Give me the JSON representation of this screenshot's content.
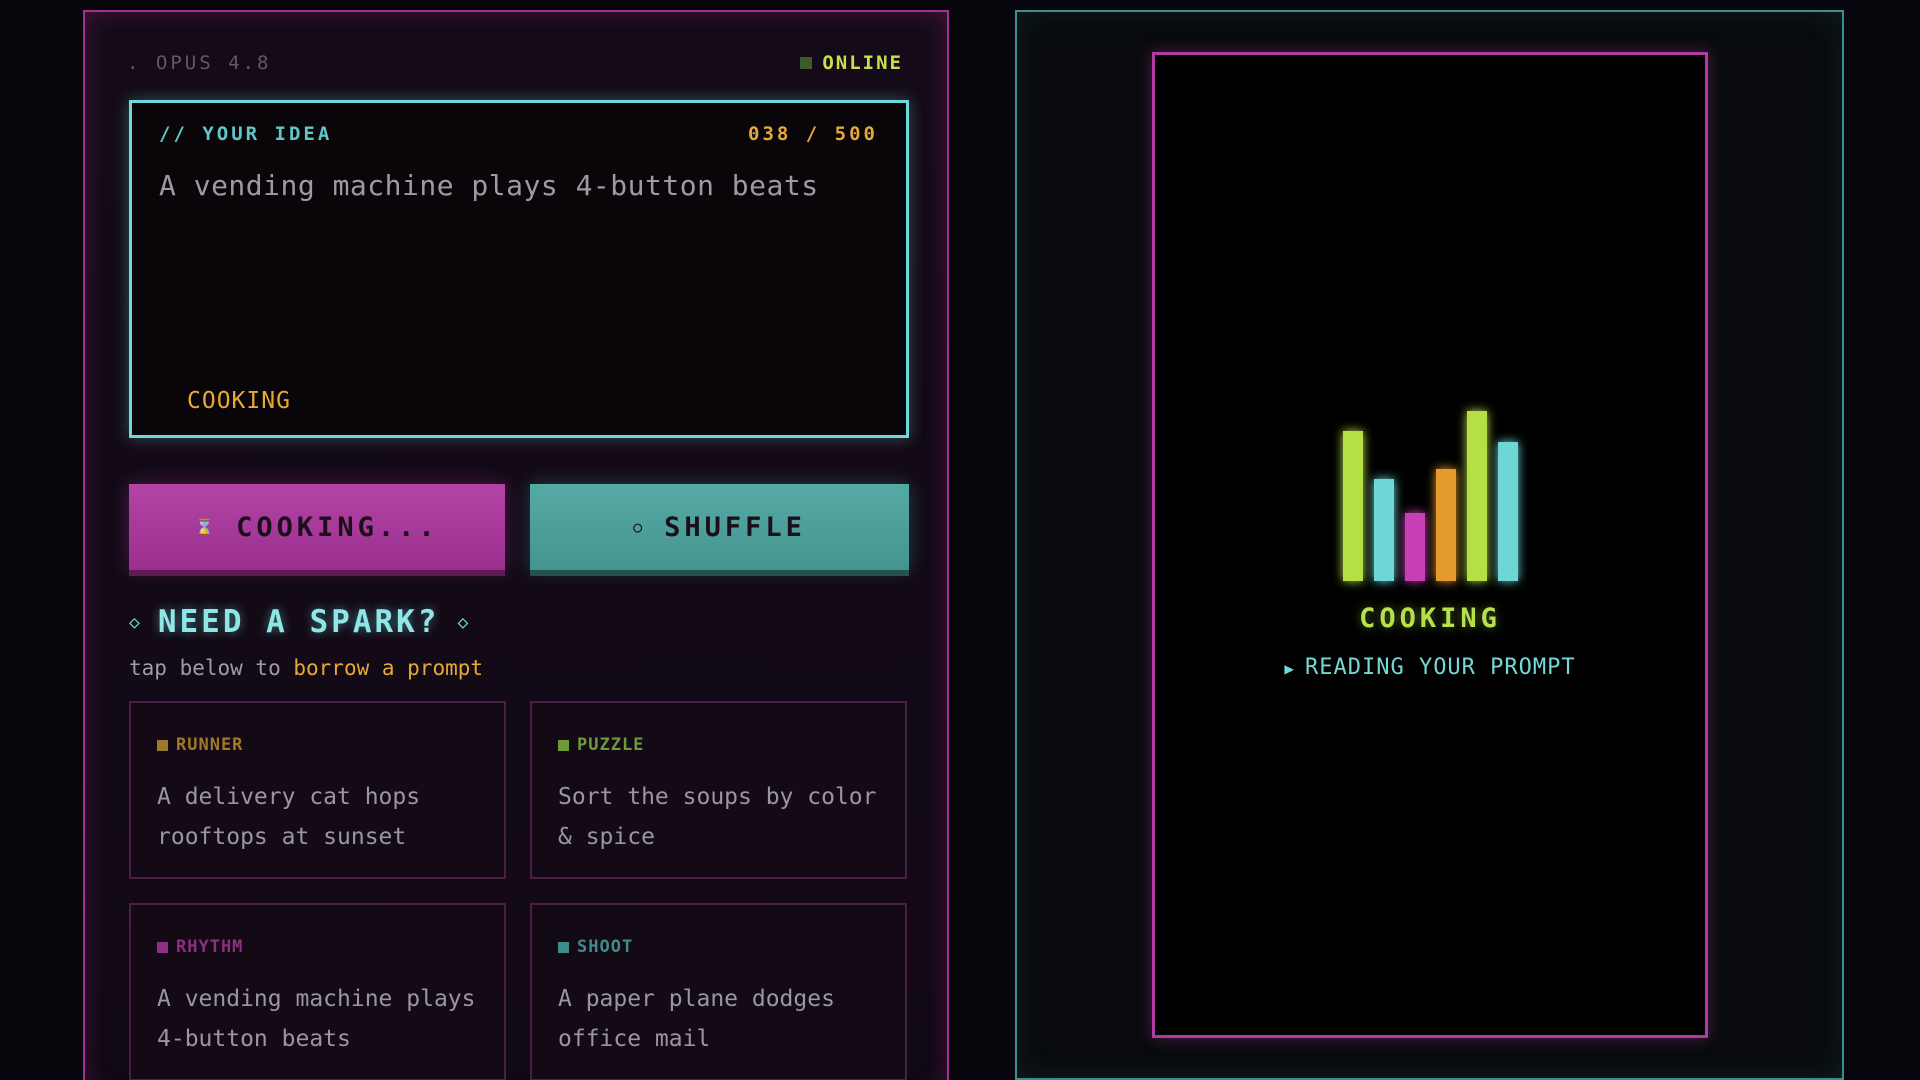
{
  "header": {
    "model": ". OPUS 4.8",
    "status": "ONLINE"
  },
  "idea": {
    "label": "// YOUR IDEA",
    "count": "038 / 500",
    "text": "A vending machine plays 4-button beats",
    "state": "COOKING"
  },
  "actions": {
    "cooking_label": "COOKING...",
    "cooking_icon": "⌛",
    "shuffle_label": "SHUFFLE",
    "shuffle_icon": "○"
  },
  "spark": {
    "title": "NEED A SPARK?",
    "subtitle_prefix": "tap below to ",
    "subtitle_highlight": "borrow a prompt"
  },
  "cards": [
    {
      "tag": "RUNNER",
      "color": "#a0782c",
      "text": "A delivery cat hops rooftops at sunset"
    },
    {
      "tag": "PUZZLE",
      "color": "#6f9a3a",
      "text": "Sort the soups by color & spice"
    },
    {
      "tag": "RHYTHM",
      "color": "#8e2f82",
      "text": "A vending machine plays 4-button beats"
    },
    {
      "tag": "SHOOT",
      "color": "#3f8c8a",
      "text": "A paper plane dodges office mail"
    }
  ],
  "preview": {
    "title": "COOKING",
    "status": "READING YOUR PROMPT",
    "play_icon": "▶",
    "equalizer": [
      {
        "level": 0.88,
        "color": "#b6df45"
      },
      {
        "level": 0.6,
        "color": "#6fd6d6"
      },
      {
        "level": 0.4,
        "color": "#c83fb5"
      },
      {
        "level": 0.66,
        "color": "#e59a2e"
      },
      {
        "level": 1.0,
        "color": "#b6df45"
      },
      {
        "level": 0.82,
        "color": "#6fd6d6"
      }
    ]
  }
}
